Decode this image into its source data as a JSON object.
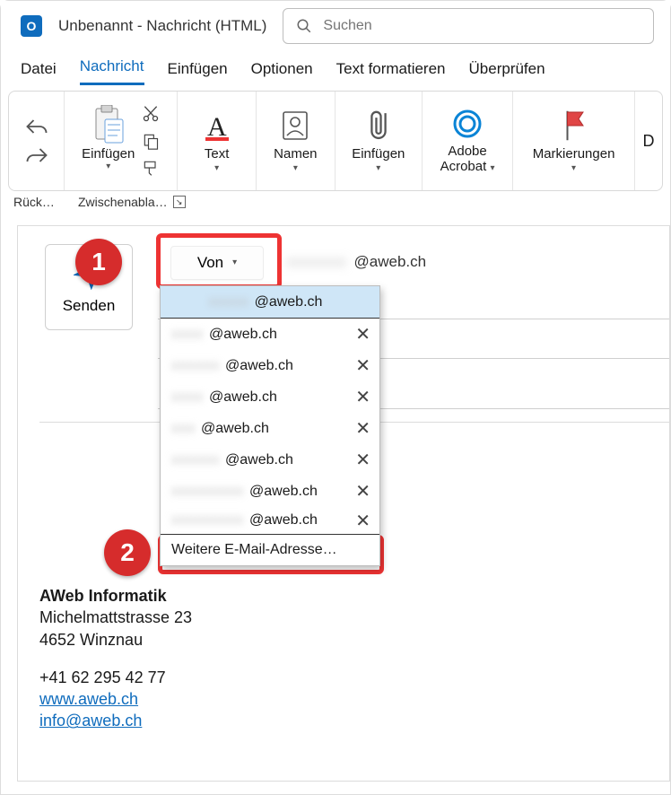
{
  "window": {
    "title": "Unbenannt  -  Nachricht (HTML)",
    "app_letter": "O"
  },
  "search": {
    "placeholder": "Suchen"
  },
  "tabs": {
    "datei": "Datei",
    "nachricht": "Nachricht",
    "einfuegen": "Einfügen",
    "optionen": "Optionen",
    "textformat": "Text formatieren",
    "ueberpruefen": "Überprüfen"
  },
  "ribbon": {
    "undo_group_caption": "Rück…",
    "paste_label": "Einfügen",
    "paste_group_caption": "Zwischenabla…",
    "text_label": "Text",
    "namen_label": "Namen",
    "einfuegen_label": "Einfügen",
    "adobe_label_l1": "Adobe",
    "adobe_label_l2": "Acrobat",
    "mark_label": "Markierungen",
    "more_letter": "D"
  },
  "compose": {
    "senden_label": "Senden",
    "von_label": "Von",
    "from_domain": "@aweb.ch"
  },
  "dropdown": {
    "selected": "@aweb.ch",
    "items": [
      {
        "domain": "@aweb.ch"
      },
      {
        "domain": "@aweb.ch"
      },
      {
        "domain": "@aweb.ch"
      },
      {
        "domain": "@aweb.ch"
      },
      {
        "domain": "@aweb.ch"
      },
      {
        "domain": "@aweb.ch"
      },
      {
        "domain": "@aweb.ch"
      }
    ],
    "more_label": "Weitere E-Mail-Adresse…"
  },
  "callouts": {
    "one": "1",
    "two": "2"
  },
  "signature": {
    "company": "AWeb Informatik",
    "street": "Michelmattstrasse 23",
    "city": "4652 Winznau",
    "phone": "+41 62 295 42 77",
    "web": "www.aweb.ch",
    "email": "info@aweb.ch"
  }
}
